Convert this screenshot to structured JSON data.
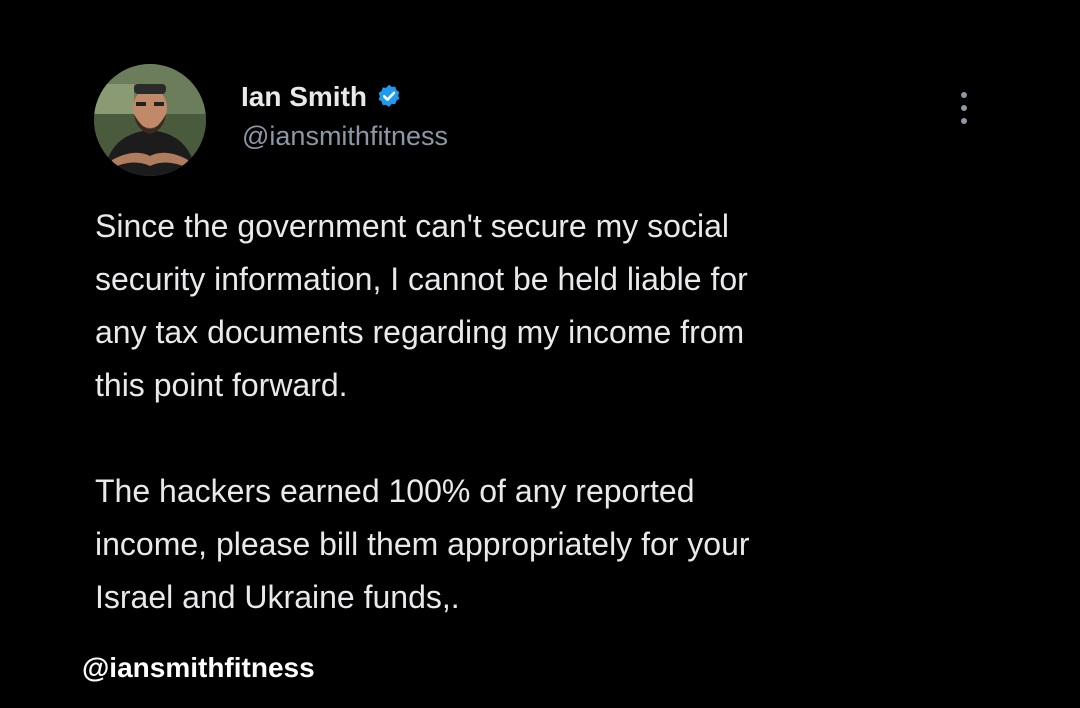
{
  "author": {
    "display_name": "Ian Smith",
    "handle": "@iansmithfitness",
    "verified": true,
    "avatar_icon": "profile-photo",
    "verified_icon": "verified-badge-icon",
    "verified_color": "#1d9bf0"
  },
  "menu": {
    "icon": "more-options-icon"
  },
  "tweet": {
    "paragraphs": [
      "Since the government can't secure my social\nsecurity information, I cannot be held liable for\nany tax documents regarding my income from\nthis point forward.",
      "The hackers earned 100% of any reported\nincome, please bill them appropriately for your\nIsrael and Ukraine funds,."
    ]
  },
  "watermark": {
    "text": "@iansmithfitness"
  },
  "colors": {
    "background": "#000000",
    "text_primary": "#e7e9ea",
    "text_secondary": "#8b98a5",
    "accent": "#1d9bf0"
  }
}
